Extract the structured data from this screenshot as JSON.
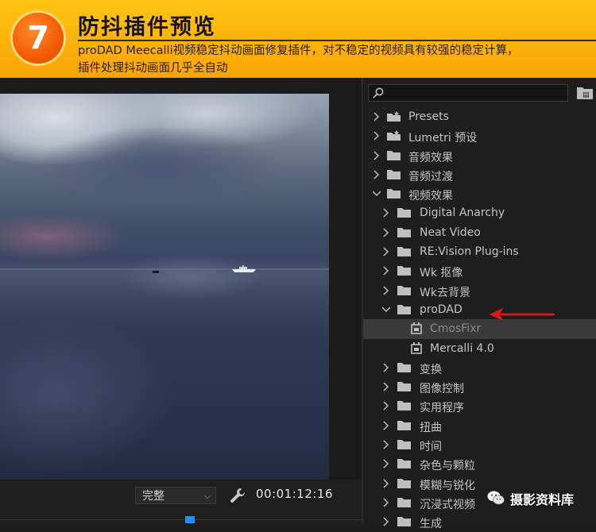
{
  "banner": {
    "step": "7",
    "title": "防抖插件预览",
    "desc_line1": "proDAD Meecalli视频稳定抖动画面修复插件，对不稳定的视频具有较强的稳定计算，",
    "desc_line2": "插件处理抖动画面几乎全自动"
  },
  "monitor": {
    "quality": "完整",
    "timecode": "00:01:12:16"
  },
  "effects_panel": {
    "search_placeholder": "",
    "items": [
      {
        "label": "Presets",
        "level": 0,
        "state": "collapsed",
        "icon": "preset-folder-icon"
      },
      {
        "label": "Lumetri 预设",
        "level": 0,
        "state": "collapsed",
        "icon": "preset-folder-icon"
      },
      {
        "label": "音频效果",
        "level": 0,
        "state": "collapsed",
        "icon": "folder-icon"
      },
      {
        "label": "音频过渡",
        "level": 0,
        "state": "collapsed",
        "icon": "folder-icon"
      },
      {
        "label": "视频效果",
        "level": 0,
        "state": "expanded",
        "icon": "folder-icon"
      },
      {
        "label": "Digital Anarchy",
        "level": 1,
        "state": "collapsed",
        "icon": "folder-icon"
      },
      {
        "label": "Neat Video",
        "level": 1,
        "state": "collapsed",
        "icon": "folder-icon"
      },
      {
        "label": "RE:Vision Plug-ins",
        "level": 1,
        "state": "collapsed",
        "icon": "folder-icon"
      },
      {
        "label": "Wk 抠像",
        "level": 1,
        "state": "collapsed",
        "icon": "folder-icon"
      },
      {
        "label": "Wk去背景",
        "level": 1,
        "state": "collapsed",
        "icon": "folder-icon"
      },
      {
        "label": "proDAD",
        "level": 1,
        "state": "expanded",
        "icon": "folder-icon"
      },
      {
        "label": "CmosFixr",
        "level": 2,
        "state": "selected",
        "icon": "effect-clip-icon"
      },
      {
        "label": "Mercalli 4.0",
        "level": 2,
        "state": "none",
        "icon": "effect-clip-icon"
      },
      {
        "label": "变换",
        "level": 1,
        "state": "collapsed",
        "icon": "folder-icon"
      },
      {
        "label": "图像控制",
        "level": 1,
        "state": "collapsed",
        "icon": "folder-icon"
      },
      {
        "label": "实用程序",
        "level": 1,
        "state": "collapsed",
        "icon": "folder-icon"
      },
      {
        "label": "扭曲",
        "level": 1,
        "state": "collapsed",
        "icon": "folder-icon"
      },
      {
        "label": "时间",
        "level": 1,
        "state": "collapsed",
        "icon": "folder-icon"
      },
      {
        "label": "杂色与颗粒",
        "level": 1,
        "state": "collapsed",
        "icon": "folder-icon"
      },
      {
        "label": "模糊与锐化",
        "level": 1,
        "state": "collapsed",
        "icon": "folder-icon"
      },
      {
        "label": "沉浸式视频",
        "level": 1,
        "state": "collapsed",
        "icon": "folder-icon"
      },
      {
        "label": "生成",
        "level": 1,
        "state": "collapsed",
        "icon": "folder-icon"
      }
    ]
  },
  "watermark": {
    "text": "摄影资料库"
  },
  "colors": {
    "banner": "#fbb20b",
    "badge": "#f25c05",
    "arrow": "#e01818",
    "playhead": "#2d8ceb"
  }
}
